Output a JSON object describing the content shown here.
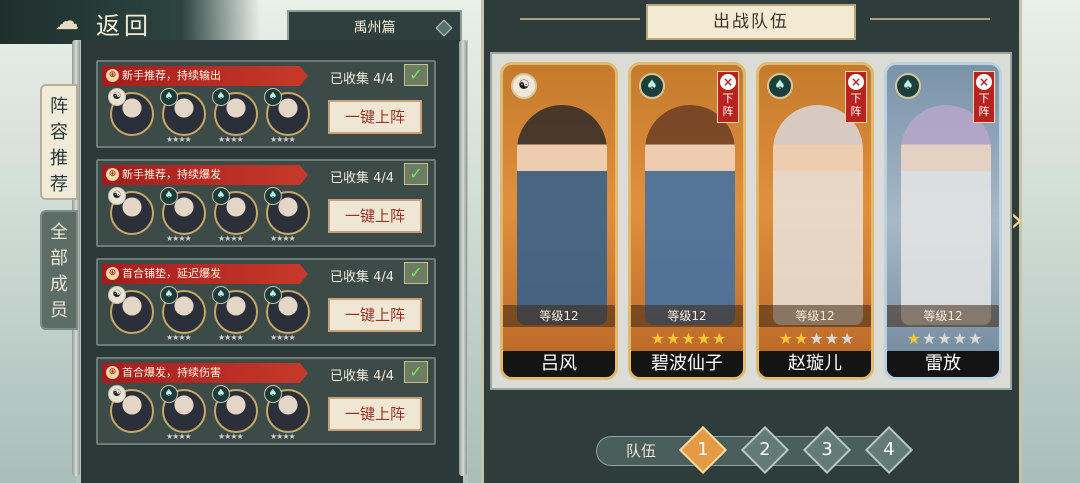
{
  "header": {
    "back_label": "返回",
    "chapter": "禹州篇"
  },
  "side_tabs": {
    "active": "阵容推荐",
    "inactive": "全部成员"
  },
  "team_cards": [
    {
      "ribbon": "新手推荐，持续输出",
      "collected": "已收集 4/4",
      "button": "一键上阵"
    },
    {
      "ribbon": "新手推荐，持续爆发",
      "collected": "已收集 4/4",
      "button": "一键上阵"
    },
    {
      "ribbon": "首合铺垫，延迟爆发",
      "collected": "已收集 4/4",
      "button": "一键上阵"
    },
    {
      "ribbon": "首合爆发，持续伤害",
      "collected": "已收集 4/4",
      "button": "一键上阵"
    }
  ],
  "right": {
    "title": "出战队伍",
    "heroes": [
      {
        "name": "吕风",
        "level": "等级12",
        "stars": 0,
        "removable": false,
        "remove_label": ""
      },
      {
        "name": "碧波仙子",
        "level": "等级12",
        "stars": 5,
        "removable": true,
        "remove_label": "下阵"
      },
      {
        "name": "赵璇儿",
        "level": "等级12",
        "stars": 2,
        "removable": true,
        "remove_label": "下阵"
      },
      {
        "name": "雷放",
        "level": "等级12",
        "stars": 1,
        "removable": true,
        "remove_label": "下阵"
      }
    ],
    "team_label": "队伍",
    "team_numbers": [
      "1",
      "2",
      "3",
      "4"
    ],
    "active_team": "1"
  },
  "colors": {
    "ribbon": "#b8231f",
    "accent": "#e59b45",
    "panel": "#2e3d3b"
  }
}
